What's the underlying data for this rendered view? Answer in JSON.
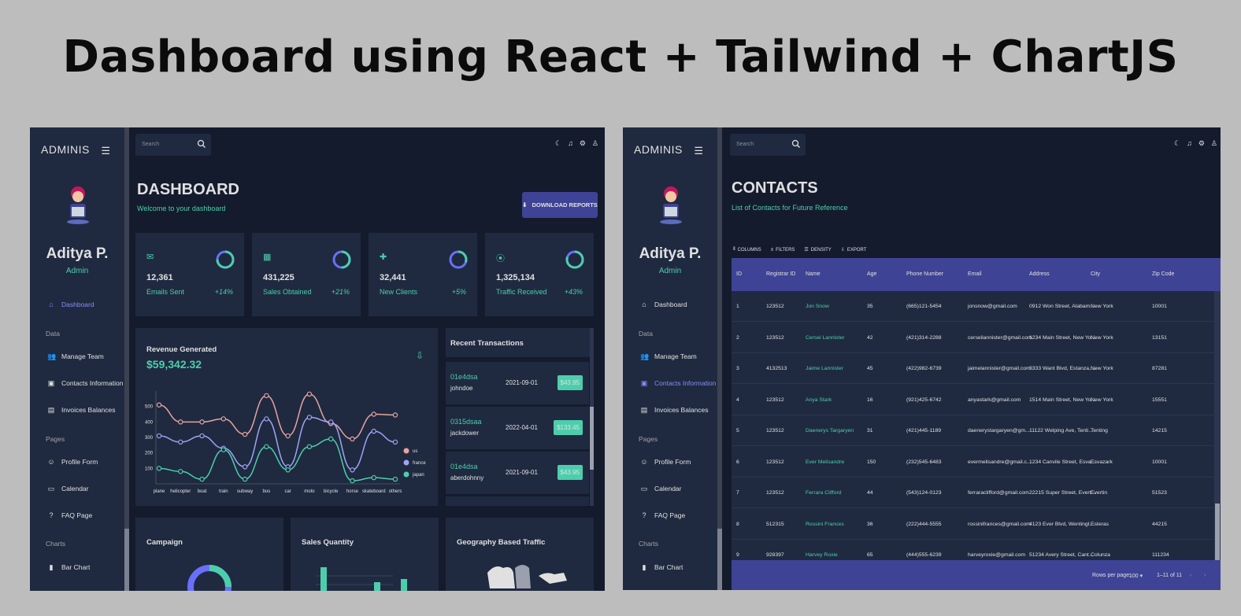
{
  "page_title": "Dashboard using React + Tailwind + ChartJS",
  "colors": {
    "accent_green": "#4cceac",
    "accent_blue": "#3e4396",
    "bg": "#141b2d",
    "card": "#1f2a40"
  },
  "sidebar": {
    "brand": "ADMINIS",
    "user_name": "Aditya P.",
    "user_role": "Admin",
    "sections": {
      "data": "Data",
      "pages": "Pages",
      "charts": "Charts"
    },
    "items": {
      "dashboard": "Dashboard",
      "manage_team": "Manage Team",
      "contacts": "Contacts Information",
      "invoices": "Invoices Balances",
      "profile": "Profile Form",
      "calendar": "Calendar",
      "faq": "FAQ Page",
      "bar": "Bar Chart"
    }
  },
  "search": {
    "placeholder": "Search"
  },
  "dashboard": {
    "title": "DASHBOARD",
    "subtitle": "Welcome to your dashboard",
    "download_label": "DOWNLOAD REPORTS",
    "stats": [
      {
        "value": "12,361",
        "label": "Emails Sent",
        "increase": "+14%",
        "progress": 0.75,
        "icon": "email-icon"
      },
      {
        "value": "431,225",
        "label": "Sales Obtained",
        "increase": "+21%",
        "progress": 0.5,
        "icon": "point-of-sale-icon"
      },
      {
        "value": "32,441",
        "label": "New Clients",
        "increase": "+5%",
        "progress": 0.3,
        "icon": "person-add-icon"
      },
      {
        "value": "1,325,134",
        "label": "Traffic Received",
        "increase": "+43%",
        "progress": 0.8,
        "icon": "traffic-icon"
      }
    ],
    "revenue_title": "Revenue Generated",
    "revenue_value": "$59,342.32",
    "transactions_title": "Recent Transactions",
    "transactions": [
      {
        "txId": "01e4dsa",
        "user": "johndoe",
        "date": "2021-09-01",
        "cost": "$43.95"
      },
      {
        "txId": "0315dsaa",
        "user": "jackdower",
        "date": "2022-04-01",
        "cost": "$133.45"
      },
      {
        "txId": "01e4dsa",
        "user": "aberdohnny",
        "date": "2021-09-01",
        "cost": "$43.95"
      }
    ],
    "campaign_title": "Campaign",
    "sales_qty_title": "Sales Quantity",
    "geo_title": "Geography Based Traffic"
  },
  "chart_data": [
    {
      "type": "line",
      "categories": [
        "plane",
        "helicopter",
        "boat",
        "train",
        "subway",
        "bus",
        "car",
        "moto",
        "bicycle",
        "horse",
        "skateboard",
        "others"
      ],
      "yticks": [
        100,
        200,
        300,
        400,
        500
      ],
      "series": [
        {
          "name": "us",
          "color": "#e8a3a0",
          "values": [
            510,
            400,
            400,
            420,
            320,
            570,
            310,
            580,
            390,
            290,
            450,
            445
          ]
        },
        {
          "name": "france",
          "color": "#9ea4f5",
          "values": [
            310,
            270,
            310,
            230,
            110,
            420,
            110,
            430,
            400,
            90,
            340,
            270
          ]
        },
        {
          "name": "japan",
          "color": "#4cceac",
          "values": [
            100,
            80,
            30,
            220,
            30,
            240,
            90,
            240,
            290,
            20,
            40,
            30
          ]
        }
      ]
    }
  ],
  "contacts": {
    "title": "CONTACTS",
    "subtitle": "List of Contacts for Future Reference",
    "toolbar": [
      "COLUMNS",
      "FILTERS",
      "DENSITY",
      "EXPORT"
    ],
    "headers": [
      "ID",
      "Registrar ID",
      "Name",
      "Age",
      "Phone Number",
      "Email",
      "Address",
      "City",
      "Zip Code"
    ],
    "rows": [
      [
        "1",
        "123512",
        "Jon Snow",
        "35",
        "(665)121-5454",
        "jonsnow@gmail.com",
        "0912 Won Street, Alabam...",
        "New York",
        "10001"
      ],
      [
        "2",
        "123512",
        "Cersei Lannister",
        "42",
        "(421)314-2288",
        "cerseilannister@gmail.com",
        "1234 Main Street, New Yo...",
        "New York",
        "13151"
      ],
      [
        "3",
        "4132513",
        "Jaime Lannister",
        "45",
        "(422)982-6739",
        "jaimelannister@gmail.com",
        "3333 Want Blvd, Estanza, ...",
        "New York",
        "87281"
      ],
      [
        "4",
        "123512",
        "Anya Stark",
        "16",
        "(921)425-6742",
        "anyastark@gmail.com",
        "1514 Main Street, New Yo...",
        "New York",
        "15551"
      ],
      [
        "5",
        "123512",
        "Daenerys Targaryen",
        "31",
        "(421)445-1189",
        "daenerystargaryen@gm...",
        "11122 Welping Ave, Tenti...",
        "Tenting",
        "14215"
      ],
      [
        "6",
        "123512",
        "Ever Melisandre",
        "150",
        "(232)545-6483",
        "evermelisandre@gmail.c...",
        "1234 Canvile Street, Esva...",
        "Esvazark",
        "10001"
      ],
      [
        "7",
        "123512",
        "Ferrara Clifford",
        "44",
        "(543)124-0123",
        "ferraraclifford@gmail.com",
        "22215 Super Street, Evert...",
        "Evertin",
        "51523"
      ],
      [
        "8",
        "512315",
        "Rossini Frances",
        "36",
        "(222)444-5555",
        "rossinifrances@gmail.com",
        "4123 Ever Blvd, Wentingt...",
        "Esteras",
        "44215"
      ],
      [
        "9",
        "928397",
        "Harvey Roxie",
        "65",
        "(444)555-6239",
        "harveyroxie@gmail.com",
        "51234 Avery Street, Cant...",
        "Colunza",
        "111234"
      ]
    ],
    "rows_per_page_label": "Rows per page:",
    "rows_per_page": "100",
    "page_range": "1–11 of 11"
  }
}
